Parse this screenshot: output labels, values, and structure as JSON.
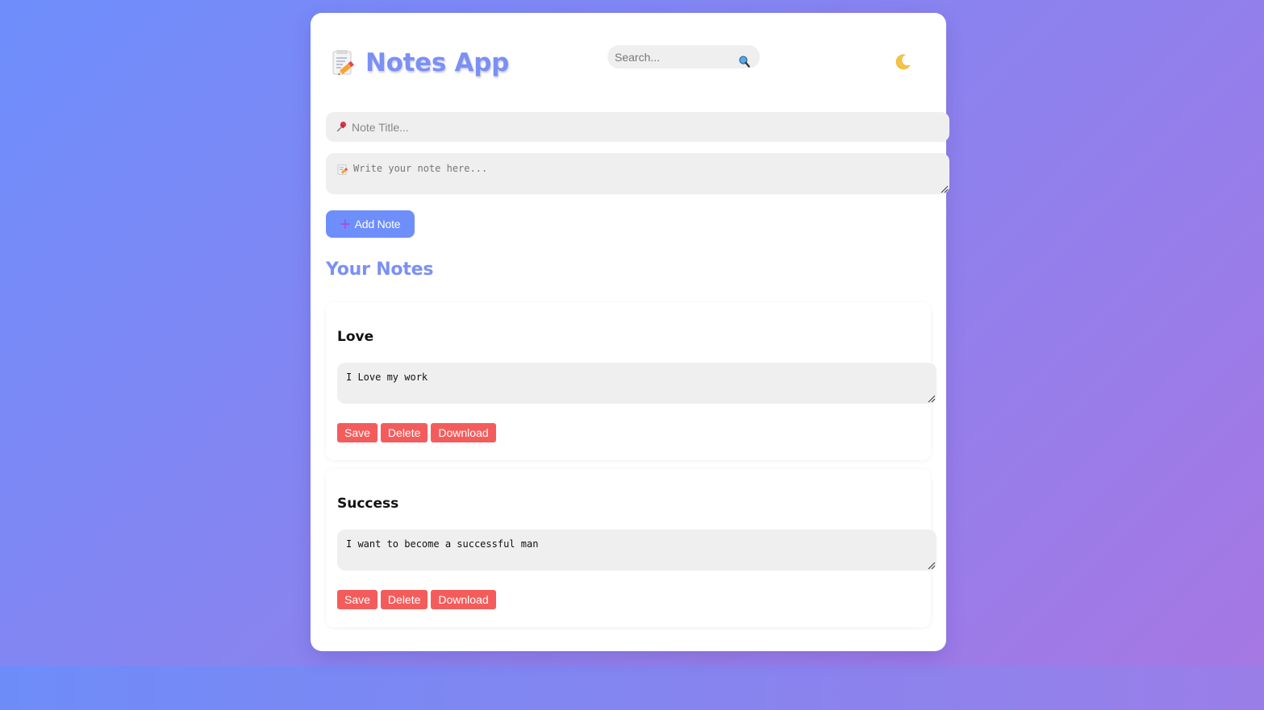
{
  "header": {
    "title": "Notes App",
    "title_icon": "memo-icon",
    "search": {
      "placeholder": "Search...",
      "value": "",
      "icon": "magnifier-icon"
    },
    "theme_toggle": {
      "icon": "crescent-moon-icon"
    }
  },
  "composer": {
    "title_placeholder": "Note Title...",
    "title_icon": "pushpin-icon",
    "body_placeholder": "Write your note here...",
    "body_icon": "memo-icon",
    "add_button_label": "Add Note",
    "add_button_icon": "plus-icon"
  },
  "notes_section": {
    "title": "Your Notes",
    "notes": [
      {
        "title": "Love",
        "body": "I Love my work",
        "actions": {
          "save": "Save",
          "delete": "Delete",
          "download": "Download"
        }
      },
      {
        "title": "Success",
        "body": "I want to become a successful man",
        "actions": {
          "save": "Save",
          "delete": "Delete",
          "download": "Download"
        }
      }
    ]
  },
  "colors": {
    "accent": "#6e8efb",
    "title_color": "#7b90f5",
    "danger": "#f45c5c",
    "field_bg": "#efefef",
    "gradient_start": "#6e8efb",
    "gradient_end": "#a777e3"
  }
}
